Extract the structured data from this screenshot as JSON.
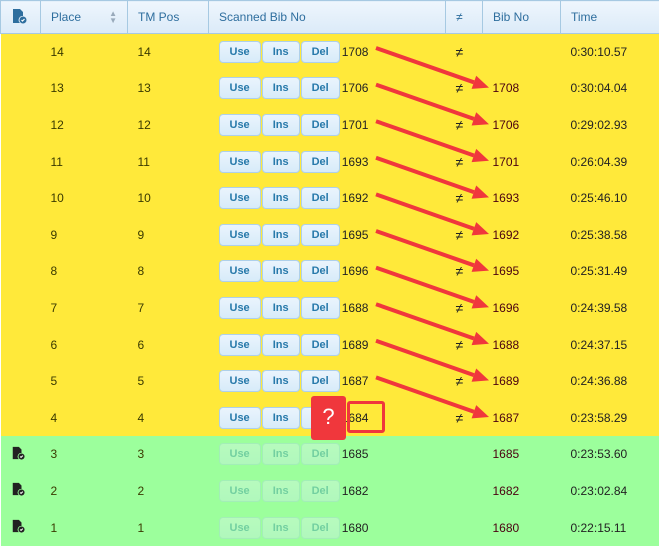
{
  "header": {
    "icon": "document-check-icon",
    "place": "Place",
    "tm_pos": "TM Pos",
    "scanned": "Scanned Bib No",
    "neq": "≠",
    "bib_no": "Bib No",
    "time": "Time"
  },
  "buttons": {
    "use": "Use",
    "ins": "Ins",
    "del": "Del"
  },
  "callout": "?",
  "colors": {
    "mismatch": "#ffe93a",
    "matched": "#9cff9c",
    "arrow": "#f0373c"
  },
  "rows": [
    {
      "place": "14",
      "tm": "14",
      "scanned": "1708",
      "neq": "≠",
      "bib": "",
      "time": "0:30:10.57",
      "status": "mismatch"
    },
    {
      "place": "13",
      "tm": "13",
      "scanned": "1706",
      "neq": "≠",
      "bib": "1708",
      "time": "0:30:04.04",
      "status": "mismatch"
    },
    {
      "place": "12",
      "tm": "12",
      "scanned": "1701",
      "neq": "≠",
      "bib": "1706",
      "time": "0:29:02.93",
      "status": "mismatch"
    },
    {
      "place": "11",
      "tm": "11",
      "scanned": "1693",
      "neq": "≠",
      "bib": "1701",
      "time": "0:26:04.39",
      "status": "mismatch"
    },
    {
      "place": "10",
      "tm": "10",
      "scanned": "1692",
      "neq": "≠",
      "bib": "1693",
      "time": "0:25:46.10",
      "status": "mismatch"
    },
    {
      "place": "9",
      "tm": "9",
      "scanned": "1695",
      "neq": "≠",
      "bib": "1692",
      "time": "0:25:38.58",
      "status": "mismatch"
    },
    {
      "place": "8",
      "tm": "8",
      "scanned": "1696",
      "neq": "≠",
      "bib": "1695",
      "time": "0:25:31.49",
      "status": "mismatch"
    },
    {
      "place": "7",
      "tm": "7",
      "scanned": "1688",
      "neq": "≠",
      "bib": "1696",
      "time": "0:24:39.58",
      "status": "mismatch"
    },
    {
      "place": "6",
      "tm": "6",
      "scanned": "1689",
      "neq": "≠",
      "bib": "1688",
      "time": "0:24:37.15",
      "status": "mismatch"
    },
    {
      "place": "5",
      "tm": "5",
      "scanned": "1687",
      "neq": "≠",
      "bib": "1689",
      "time": "0:24:36.88",
      "status": "mismatch"
    },
    {
      "place": "4",
      "tm": "4",
      "scanned": "1684",
      "neq": "≠",
      "bib": "1687",
      "time": "0:23:58.29",
      "status": "mismatch"
    },
    {
      "place": "3",
      "tm": "3",
      "scanned": "1685",
      "neq": "",
      "bib": "1685",
      "time": "0:23:53.60",
      "status": "matched"
    },
    {
      "place": "2",
      "tm": "2",
      "scanned": "1682",
      "neq": "",
      "bib": "1682",
      "time": "0:23:02.84",
      "status": "matched"
    },
    {
      "place": "1",
      "tm": "1",
      "scanned": "1680",
      "neq": "",
      "bib": "1680",
      "time": "0:22:15.11",
      "status": "matched"
    }
  ]
}
